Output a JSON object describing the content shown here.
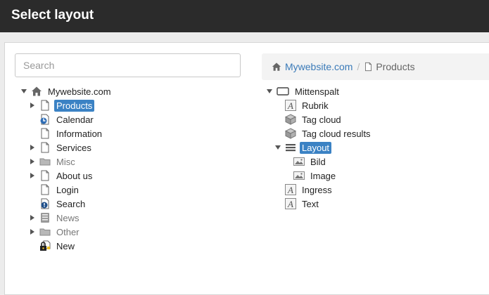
{
  "dialog": {
    "title": "Select layout"
  },
  "search": {
    "placeholder": "Search"
  },
  "breadcrumb": {
    "root": "Mywebsite.com",
    "current": "Products"
  },
  "left_tree": {
    "root": "Mywebsite.com",
    "items": [
      {
        "label": "Products",
        "icon": "page-icon",
        "expandable": true,
        "selected": true
      },
      {
        "label": "Calendar",
        "icon": "calendar-page-icon",
        "expandable": false
      },
      {
        "label": "Information",
        "icon": "page-icon",
        "expandable": false
      },
      {
        "label": "Services",
        "icon": "page-icon",
        "expandable": true
      },
      {
        "label": "Misc",
        "icon": "folder-icon",
        "expandable": true
      },
      {
        "label": "About us",
        "icon": "page-icon",
        "expandable": true
      },
      {
        "label": "Login",
        "icon": "page-icon",
        "expandable": false
      },
      {
        "label": "Search",
        "icon": "search-page-icon",
        "expandable": false
      },
      {
        "label": "News",
        "icon": "news-archive-icon",
        "expandable": true
      },
      {
        "label": "Other",
        "icon": "folder-icon",
        "expandable": true
      },
      {
        "label": "New",
        "icon": "locked-page-icon",
        "expandable": false
      }
    ]
  },
  "right_tree": {
    "root": "Mittenspalt",
    "items": [
      {
        "label": "Rubrik",
        "icon": "text-block-icon"
      },
      {
        "label": "Tag cloud",
        "icon": "cube-icon"
      },
      {
        "label": "Tag cloud results",
        "icon": "cube-icon"
      },
      {
        "label": "Layout",
        "icon": "layout-icon",
        "selected": true
      },
      {
        "label": "Bild",
        "icon": "image-icon"
      },
      {
        "label": "Image",
        "icon": "image-icon"
      },
      {
        "label": "Ingress",
        "icon": "text-block-icon"
      },
      {
        "label": "Text",
        "icon": "text-block-icon"
      }
    ]
  },
  "colors": {
    "header_bg": "#2b2b2b",
    "selected_bg": "#3b82c4",
    "link": "#3a7ab8"
  }
}
